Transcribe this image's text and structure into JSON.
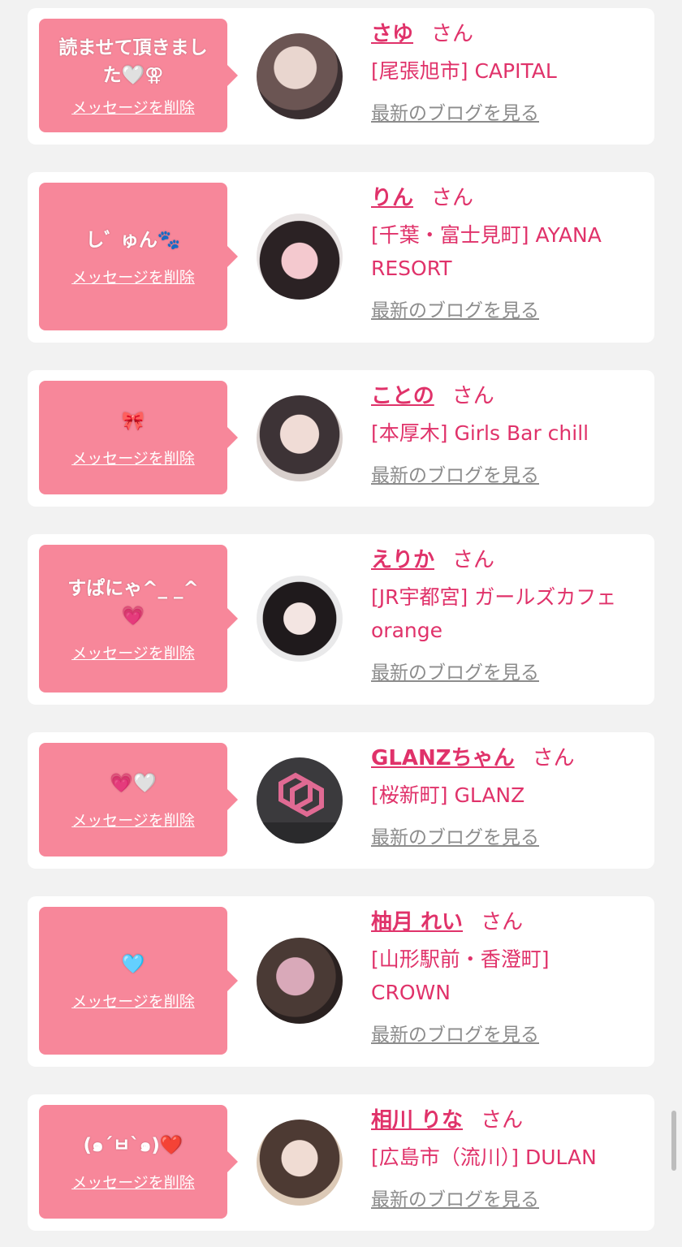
{
  "delete_label": "メッセージを削除",
  "suffix": "さん",
  "blog_label": "最新のブログを見る",
  "entries": [
    {
      "message": "読ませて頂きました🤍⚢",
      "name": "さゆ",
      "shop": "[尾張旭市] CAPITAL"
    },
    {
      "message": "しﾞ ゅん🐾",
      "name": "りん",
      "shop": "[千葉・富士見町] AYANA RESORT"
    },
    {
      "message": "🎀",
      "name": "ことの",
      "shop": "[本厚木] Girls Bar chill"
    },
    {
      "message": "すぱにゃ^_ _^ 💗",
      "name": "えりか",
      "shop": "[JR宇都宮] ガールズカフェ orange"
    },
    {
      "message": "💗🤍",
      "name": "GLANZちゃん",
      "shop": "[桜新町] GLANZ"
    },
    {
      "message": "🩵",
      "name": "柚月 れい",
      "shop": "[山形駅前・香澄町] CROWN"
    },
    {
      "message": "(๑´ㅂ`๑)❤️",
      "name": "相川 りな",
      "shop": "[広島市（流川）] DULAN"
    }
  ]
}
